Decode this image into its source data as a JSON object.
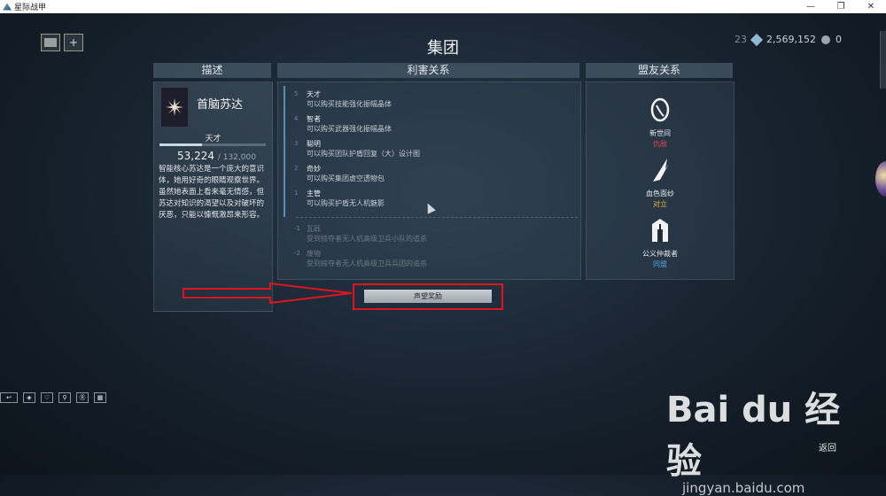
{
  "window": {
    "title": "星际战甲",
    "controls": [
      "—",
      "❐",
      "✕"
    ]
  },
  "topbar": {
    "add_label": "+",
    "page_title": "集团",
    "mastery_rank": "23",
    "platinum": "2,569,152",
    "credits": "0"
  },
  "columns": {
    "description": "描述",
    "relations": "利害关系",
    "alliances": "盟友关系"
  },
  "syndicate": {
    "name": "首脑苏达",
    "rank_title": "天才",
    "standing_current": "53,224",
    "standing_max": "/ 132,000",
    "standing_progress": 0.4,
    "description": "智能核心苏达是一个庞大的意识体，她用好奇的眼睛观察世界。虽然她表面上看来毫无情感，但苏达对知识的渴望以及对破坏的厌恶，只能以慷慨激昂来形容。"
  },
  "ranks": [
    {
      "num": "5",
      "title": "天才",
      "desc": "可以购买技能强化振幅晶体",
      "locked": false
    },
    {
      "num": "4",
      "title": "智者",
      "desc": "可以购买武器强化振幅晶体",
      "locked": false
    },
    {
      "num": "3",
      "title": "聪明",
      "desc": "可以购买团队护盾回复（大）设计图",
      "locked": false
    },
    {
      "num": "2",
      "title": "奇妙",
      "desc": "可以购买集团虚空透物包",
      "locked": false
    },
    {
      "num": "1",
      "title": "主管",
      "desc": "可以购买护盾无人机魅影",
      "locked": false
    },
    {
      "num": "-1",
      "title": "瓦砾",
      "desc": "受到掠夺者无人机高级卫兵小队的追杀",
      "locked": true
    },
    {
      "num": "-2",
      "title": "废物",
      "desc": "受到掠夺者无人机高级卫兵兵团的追杀",
      "locked": true
    }
  ],
  "allies": [
    {
      "name": "新世间",
      "relation": "仇敌",
      "color": "#e2464a",
      "icon": "new-loka-icon"
    },
    {
      "name": "血色面纱",
      "relation": "对立",
      "color": "#e6b43c",
      "icon": "red-veil-icon"
    },
    {
      "name": "公义仲裁者",
      "relation": "同盟",
      "color": "#4fa6e6",
      "icon": "arbiters-icon"
    }
  ],
  "rewards_button": "声望奖励",
  "quickbar": [
    "↩",
    "◈",
    "♡",
    "⚲",
    "Ⓡ",
    "▦"
  ],
  "back_label": "返回",
  "watermark": {
    "logo": "Bai du 经验",
    "url": "jingyan.baidu.com"
  }
}
